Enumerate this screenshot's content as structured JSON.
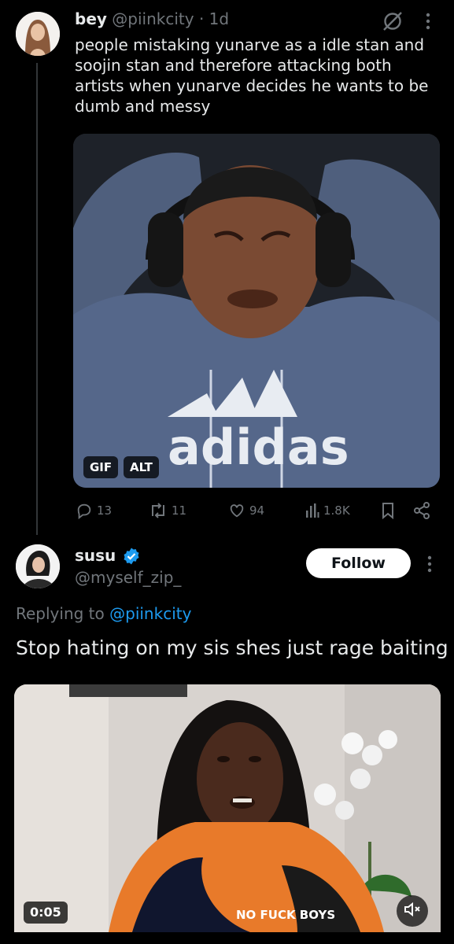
{
  "parent_tweet": {
    "author_name": "bey",
    "author_handle": "@piinkcity",
    "separator": "·",
    "time": "1d",
    "text": "people mistaking yunarve as a idle stan and soojin stan and therefore attacking both artists when yunarve decides he wants to be dumb and messy",
    "media": {
      "gif_label": "GIF",
      "alt_label": "ALT",
      "shirt_text": "adidas"
    },
    "actions": {
      "replies": "13",
      "reposts": "11",
      "likes": "94",
      "views": "1.8K"
    }
  },
  "reply_tweet": {
    "author_name": "susu",
    "author_handle": "@myself_zip_",
    "follow_label": "Follow",
    "replying_prefix": "Replying to",
    "replying_to": "@piinkcity",
    "text": "Stop hating on my sis shes just rage baiting",
    "video": {
      "duration": "0:05",
      "shirt_text": "NO FUCK BOYS"
    }
  },
  "colors": {
    "background": "#000000",
    "primary_text": "#e7e9ea",
    "secondary_text": "#71767b",
    "accent_blue": "#1d9bf0",
    "thread_line": "#333639"
  },
  "icons": [
    "grok-icon",
    "more-icon",
    "reply-icon",
    "repost-icon",
    "like-icon",
    "views-icon",
    "bookmark-icon",
    "share-icon",
    "verified-badge-icon",
    "mute-icon"
  ]
}
